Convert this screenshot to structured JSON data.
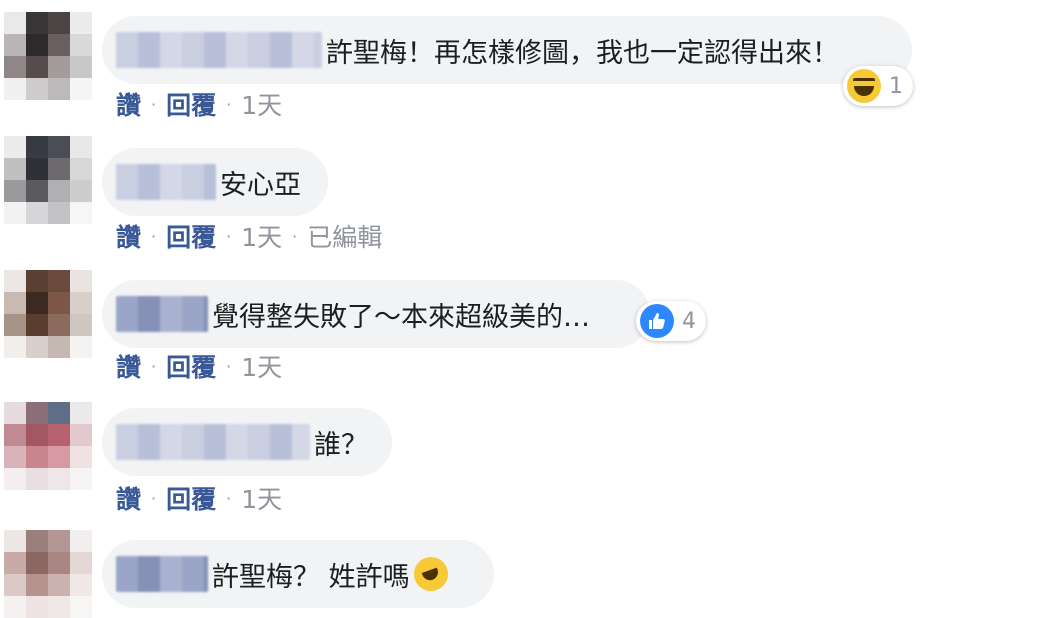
{
  "actions": {
    "like": "讚",
    "reply": "回覆",
    "separator": "·"
  },
  "comments": [
    {
      "text": "許聖梅！再怎樣修圖，我也一定認得出來！",
      "time": "1天",
      "edited": "",
      "reaction": {
        "icon": "haha-emoji-icon",
        "count": "1"
      }
    },
    {
      "text": "安心亞",
      "time": "1天",
      "edited": "已編輯",
      "reaction": null
    },
    {
      "text": "覺得整失敗了～本來超級美的…",
      "time": "1天",
      "edited": "",
      "reaction": {
        "icon": "like-thumb-icon",
        "count": "4"
      }
    },
    {
      "text": "誰？",
      "time": "1天",
      "edited": "",
      "reaction": null
    },
    {
      "text": "許聖梅？ 姓許嗎",
      "time": "",
      "edited": "",
      "reaction": null
    }
  ],
  "colors": {
    "link": "#385898",
    "bubble": "#f2f3f5",
    "meta": "#90949c",
    "like_blue": "#2d88ff",
    "emoji_yellow": "#f7c937"
  }
}
